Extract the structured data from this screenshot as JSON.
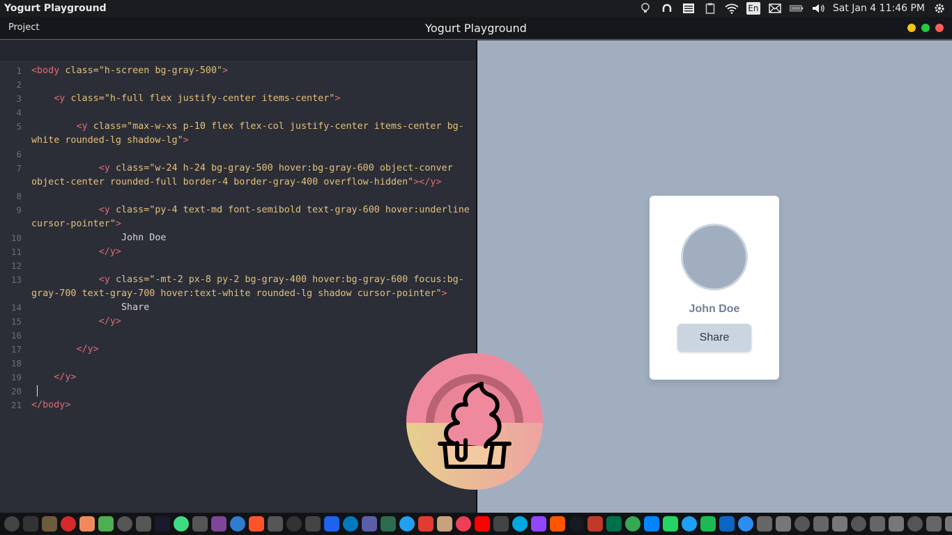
{
  "system_bar": {
    "app_name": "Yogurt Playground",
    "language": "En",
    "clock": "Sat Jan  4 11:46 PM",
    "tray_icons": [
      "lightbulb-icon",
      "headphones-icon",
      "list-icon",
      "clipboard-icon",
      "wifi-icon",
      "keyboard-language-icon",
      "mail-icon",
      "battery-icon",
      "volume-icon",
      "settings-gear-icon"
    ]
  },
  "window": {
    "menu_project": "Project",
    "title": "Yogurt Playground",
    "traffic_lights": {
      "minimize": "#f5c518",
      "maximize": "#27c93f",
      "close": "#ff5f57"
    }
  },
  "editor": {
    "line_numbers": [
      "1",
      "2",
      "3",
      "4",
      "5",
      "6",
      "7",
      "8",
      "9",
      "10",
      "11",
      "12",
      "13",
      "14",
      "15",
      "16",
      "17",
      "18",
      "19",
      "20",
      "21"
    ],
    "lines": [
      {
        "indent": "",
        "tag_open": "<body ",
        "attr": "class=",
        "value": "\"h-screen bg-gray-500\"",
        "tag_close": ">"
      },
      {},
      {
        "indent": "    ",
        "tag_open": "<y ",
        "attr": "class=",
        "value": "\"h-full flex justify-center items-center\"",
        "tag_close": ">"
      },
      {},
      {
        "indent": "        ",
        "tag_open": "<y ",
        "attr": "class=",
        "value": "\"max-w-xs p-10 flex flex-col justify-center items-center bg-",
        "tag_close": ""
      },
      {
        "indent": "",
        "tag_open": "",
        "attr": "",
        "value": "white rounded-lg shadow-lg\"",
        "tag_close": ">"
      },
      {},
      {
        "indent": "            ",
        "tag_open": "<y ",
        "attr": "class=",
        "value": "\"w-24 h-24 bg-gray-500 hover:bg-gray-600 object-conver",
        "tag_close": ""
      },
      {
        "indent": "",
        "tag_open": "",
        "attr": "",
        "value": "object-center rounded-full border-4 border-gray-400 overflow-hidden\"",
        "tag_close": "></y>"
      },
      {},
      {
        "indent": "            ",
        "tag_open": "<y ",
        "attr": "class=",
        "value": "\"py-4 text-md font-semibold text-gray-600 hover:underline",
        "tag_close": ""
      },
      {
        "indent": "",
        "tag_open": "",
        "attr": "",
        "value": "cursor-pointer\"",
        "tag_close": ">"
      },
      {
        "indent": "                ",
        "text": "John Doe"
      },
      {
        "indent": "            ",
        "tag_open": "</y>"
      },
      {},
      {
        "indent": "            ",
        "tag_open": "<y ",
        "attr": "class=",
        "value": "\"-mt-2 px-8 py-2 bg-gray-400 hover:bg-gray-600 focus:bg-",
        "tag_close": ""
      },
      {
        "indent": "",
        "tag_open": "",
        "attr": "",
        "value": "gray-700 text-gray-700 hover:text-white rounded-lg shadow cursor-pointer\"",
        "tag_close": ">"
      },
      {
        "indent": "                ",
        "text": "Share"
      },
      {
        "indent": "            ",
        "tag_open": "</y>"
      },
      {},
      {
        "indent": "        ",
        "tag_open": "</y>"
      },
      {},
      {
        "indent": "    ",
        "tag_open": "</y>"
      },
      {
        "cursor": true
      },
      {
        "indent": "",
        "tag_open": "</body>"
      }
    ],
    "gutter_map": [
      "1",
      "2",
      "3",
      "4",
      "5",
      "",
      "6",
      "7",
      "",
      "8",
      "9",
      "",
      "10",
      "11",
      "12",
      "13",
      "",
      "14",
      "15",
      "16",
      "17",
      "18",
      "19",
      "20",
      "21"
    ]
  },
  "preview": {
    "card_name": "John Doe",
    "share_label": "Share",
    "colors": {
      "bg": "#a0aec0",
      "card": "#ffffff",
      "avatar": "#a0aec0",
      "avatar_border": "#cbd5e0",
      "button": "#cbd5e0"
    }
  },
  "logo": {
    "name": "frozen-yogurt-logo-icon",
    "colors": {
      "pink": "#ef8a9e",
      "sand": "#e2c98e",
      "shadow": "#b86273"
    }
  },
  "dock": {
    "icons": [
      "activities-icon",
      "terminal-icon",
      "files-icon",
      "opera-icon",
      "orange-app-icon",
      "chrome-icon",
      "headset-icon",
      "headset2-icon",
      "webstorm-icon",
      "android-studio-icon",
      "editor-icon",
      "tor-icon",
      "box-icon",
      "brave-icon",
      "apps-icon",
      "github-icon",
      "ghost-icon",
      "docker-icon",
      "trello-icon",
      "cube-icon",
      "app-icon",
      "play-icon",
      "news-icon",
      "paint-icon",
      "pocket-icon",
      "youtube-icon",
      "ubuntu-icon",
      "prime-icon",
      "twitch-icon",
      "soundcloud-icon",
      "steam-icon",
      "car-icon",
      "starbucks-icon",
      "chat-icon",
      "messenger-icon",
      "whatsapp-icon",
      "twitter-icon",
      "spotify-icon",
      "linkedin-icon",
      "hub-icon",
      "misc1-icon",
      "misc2-icon",
      "misc3-icon",
      "misc4-icon",
      "misc5-icon",
      "misc6-icon",
      "misc7-icon",
      "misc8-icon",
      "misc9-icon",
      "misc10-icon",
      "misc11-icon",
      "misc12-icon",
      "misc13-icon",
      "misc14-icon",
      "misc15-icon",
      "misc16-icon",
      "misc17-icon",
      "misc18-icon",
      "trash-icon",
      "power-icon"
    ],
    "colors": [
      "#444",
      "#333",
      "#6d5b3e",
      "#d62a2a",
      "#f08a5d",
      "#4caf50",
      "#555",
      "#555",
      "#1a1a2e",
      "#3ddc84",
      "#555",
      "#7d4698",
      "#2e7dd1",
      "#fb542b",
      "#555",
      "#333",
      "#444",
      "#1d63ed",
      "#0079bf",
      "#5b5ea6",
      "#2d6a4f",
      "#1ea1f2",
      "#e03c31",
      "#c8a27c",
      "#ef3f56",
      "#ff0000",
      "#444",
      "#00a8e1",
      "#9146ff",
      "#ff5500",
      "#171a21",
      "#c0392b",
      "#00704a",
      "#34a853",
      "#0084ff",
      "#25d366",
      "#1da1f2",
      "#1db954",
      "#0a66c2",
      "#2d8cf0",
      "#666",
      "#777",
      "#555",
      "#666",
      "#777",
      "#555",
      "#666",
      "#777",
      "#555",
      "#666",
      "#777",
      "#555",
      "#666",
      "#777",
      "#555",
      "#666",
      "#777",
      "#555",
      "#888",
      "#444"
    ]
  }
}
